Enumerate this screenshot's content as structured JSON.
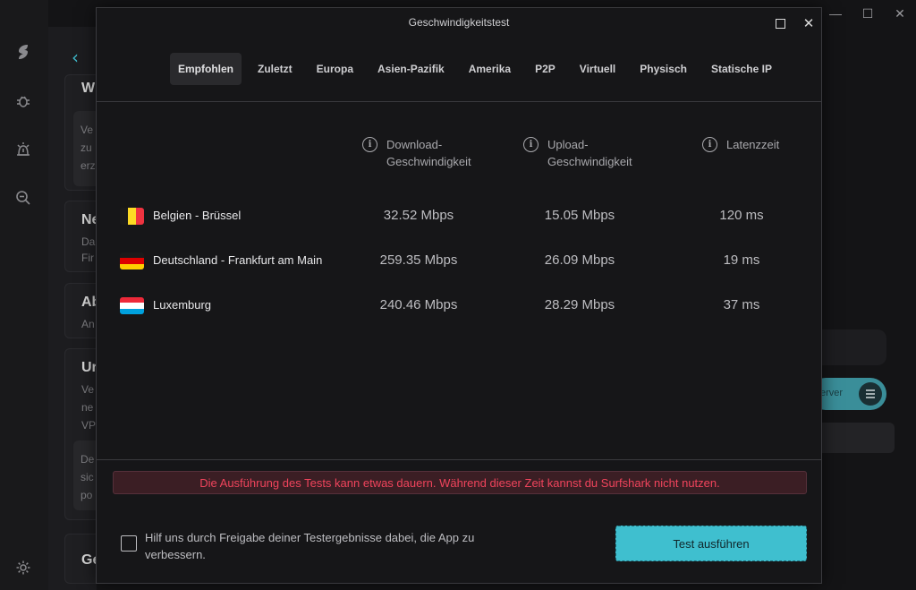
{
  "background": {
    "cards": [
      {
        "title": "W",
        "lines": [
          "Ve",
          "zu",
          "erz"
        ]
      },
      {
        "title": "Ne",
        "lines": [
          "Da",
          "Fir"
        ]
      },
      {
        "title": "Ab",
        "lines": [
          "An"
        ]
      },
      {
        "title": "Ur",
        "lines": [
          "Ve",
          "ne",
          "VP"
        ]
      },
      {
        "title": "",
        "lines": [
          "De",
          "sic",
          "po"
        ]
      },
      {
        "title": "Ge",
        "lines": []
      }
    ],
    "server_label": "erver"
  },
  "dialog": {
    "title": "Geschwindigkeitstest",
    "tabs": [
      {
        "label": "Empfohlen",
        "active": true
      },
      {
        "label": "Zuletzt",
        "active": false
      },
      {
        "label": "Europa",
        "active": false
      },
      {
        "label": "Asien-Pazifik",
        "active": false
      },
      {
        "label": "Amerika",
        "active": false
      },
      {
        "label": "P2P",
        "active": false
      },
      {
        "label": "Virtuell",
        "active": false
      },
      {
        "label": "Physisch",
        "active": false
      },
      {
        "label": "Statische IP",
        "active": false
      }
    ],
    "columns": {
      "download_l1": "Download-",
      "download_l2": "Geschwindigkeit",
      "upload_l1": "Upload-",
      "upload_l2": "Geschwindigkeit",
      "latency": "Latenzzeit"
    },
    "rows": [
      {
        "location": "Belgien - Brüssel",
        "download": "32.52 Mbps",
        "upload": "15.05 Mbps",
        "latency": "120 ms",
        "flag_colors": [
          "#1a1a1a",
          "#fdda24",
          "#ef3340"
        ],
        "flag_dir": "vertical"
      },
      {
        "location": "Deutschland - Frankfurt am Main",
        "download": "259.35 Mbps",
        "upload": "26.09 Mbps",
        "latency": "19 ms",
        "flag_colors": [
          "#1a1a1a",
          "#dd0000",
          "#ffce00"
        ],
        "flag_dir": "horizontal"
      },
      {
        "location": "Luxemburg",
        "download": "240.46 Mbps",
        "upload": "28.29 Mbps",
        "latency": "37 ms",
        "flag_colors": [
          "#ed2939",
          "#ffffff",
          "#00a1de"
        ],
        "flag_dir": "horizontal"
      }
    ],
    "warning": "Die Ausführung des Tests kann etwas dauern. Während dieser Zeit kannst du Surfshark nicht nutzen.",
    "consent_label": "Hilf uns durch Freigabe deiner Testergebnisse dabei, die App zu verbessern.",
    "run_button": "Test ausführen",
    "info_glyph": "i",
    "close_glyph": "✕"
  },
  "colors": {
    "accent": "#3fbfcf",
    "warning_text": "#f0445c",
    "warning_bg": "#3b1e24"
  }
}
